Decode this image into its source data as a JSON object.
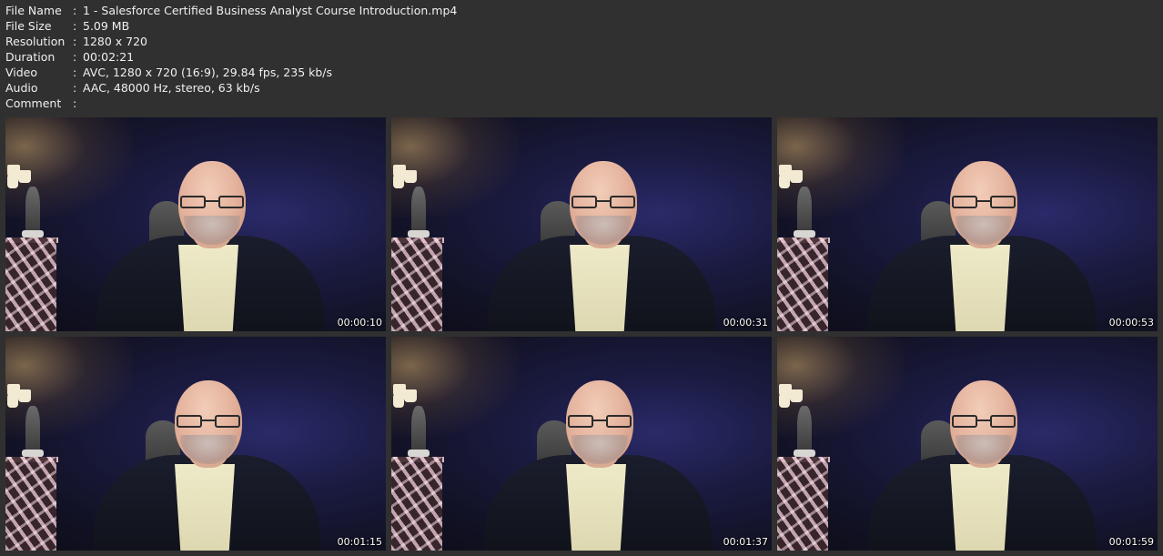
{
  "info": {
    "rows": [
      {
        "key": "File Name",
        "sep": ":",
        "value": "1 - Salesforce Certified Business Analyst Course Introduction.mp4"
      },
      {
        "key": "File Size",
        "sep": ":",
        "value": "5.09 MB"
      },
      {
        "key": "Resolution",
        "sep": ":",
        "value": "1280 x 720"
      },
      {
        "key": "Duration",
        "sep": ":",
        "value": "00:02:21"
      },
      {
        "key": "Video",
        "sep": ":",
        "value": "AVC, 1280 x 720 (16:9), 29.84 fps, 235 kb/s"
      },
      {
        "key": "Audio",
        "sep": ":",
        "value": "AAC, 48000 Hz, stereo, 63 kb/s"
      },
      {
        "key": "Comment",
        "sep": ":",
        "value": ""
      }
    ]
  },
  "thumbnails": [
    {
      "timestamp": "00:00:10"
    },
    {
      "timestamp": "00:00:31"
    },
    {
      "timestamp": "00:00:53"
    },
    {
      "timestamp": "00:01:15"
    },
    {
      "timestamp": "00:01:37"
    },
    {
      "timestamp": "00:01:59"
    }
  ],
  "colors": {
    "background": "#303030",
    "text": "#f0f0f0"
  }
}
